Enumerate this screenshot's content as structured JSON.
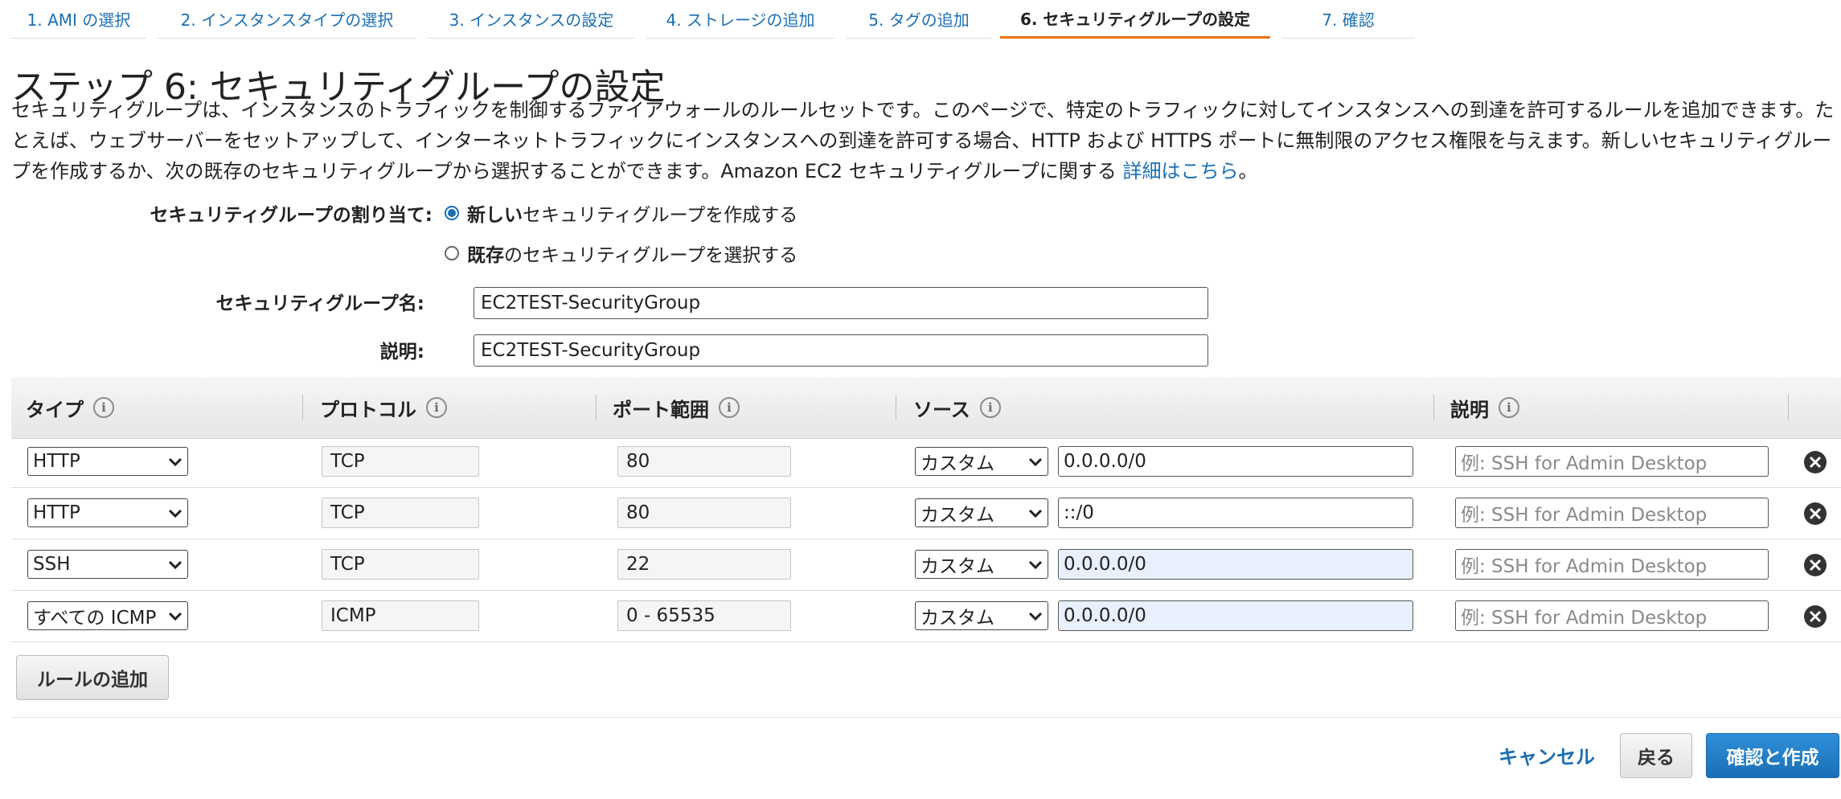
{
  "wizard": {
    "tabs": [
      {
        "label": "1. AMI の選択"
      },
      {
        "label": "2. インスタンスタイプの選択"
      },
      {
        "label": "3. インスタンスの設定"
      },
      {
        "label": "4. ストレージの追加"
      },
      {
        "label": "5. タグの追加"
      },
      {
        "label": "6. セキュリティグループの設定",
        "active": true
      },
      {
        "label": "7. 確認"
      }
    ]
  },
  "page": {
    "title": "ステップ 6: セキュリティグループの設定",
    "description": "セキュリティグループは、インスタンスのトラフィックを制御するファイアウォールのルールセットです。このページで、特定のトラフィックに対してインスタンスへの到達を許可するルールを追加できます。たとえば、ウェブサーバーをセットアップして、インターネットトラフィックにインスタンスへの到達を許可する場合、HTTP および HTTPS ポートに無制限のアクセス権限を与えます。新しいセキュリティグループを作成するか、次の既存のセキュリティグループから選択することができます。Amazon EC2 セキュリティグループに関する",
    "learn_more": "詳細はこちら",
    "period": "。"
  },
  "assignment": {
    "label": "セキュリティグループの割り当て:",
    "option_new_bold": "新しい",
    "option_new_rest": "セキュリティグループを作成する",
    "option_existing_bold": "既存",
    "option_existing_rest": "のセキュリティグループを選択する",
    "selected": "new"
  },
  "form": {
    "name_label": "セキュリティグループ名:",
    "name_value": "EC2TEST-SecurityGroup",
    "desc_label": "説明:",
    "desc_value": "EC2TEST-SecurityGroup"
  },
  "table": {
    "headers": [
      "タイプ",
      "プロトコル",
      "ポート範囲",
      "ソース",
      "説明"
    ],
    "rows": [
      {
        "type": "HTTP",
        "protocol": "TCP",
        "port": "80",
        "source_type": "カスタム",
        "source": "0.0.0.0/0",
        "desc_placeholder": "例: SSH for Admin Desktop"
      },
      {
        "type": "HTTP",
        "protocol": "TCP",
        "port": "80",
        "source_type": "カスタム",
        "source": "::/0",
        "desc_placeholder": "例: SSH for Admin Desktop"
      },
      {
        "type": "SSH",
        "protocol": "TCP",
        "port": "22",
        "source_type": "カスタム",
        "source": "0.0.0.0/0",
        "desc_placeholder": "例: SSH for Admin Desktop"
      },
      {
        "type": "すべての ICMP",
        "protocol": "ICMP",
        "port": "0 - 65535",
        "source_type": "カスタム",
        "source": "0.0.0.0/0",
        "desc_placeholder": "例: SSH for Admin Desktop"
      }
    ],
    "add_rule": "ルールの追加"
  },
  "footer": {
    "cancel": "キャンセル",
    "back": "戻る",
    "review_launch": "確認と作成"
  },
  "colors": {
    "link": "#1a6fb5",
    "active_tab_underline": "#ec7211",
    "highlight_input": "#e8f0fe"
  }
}
